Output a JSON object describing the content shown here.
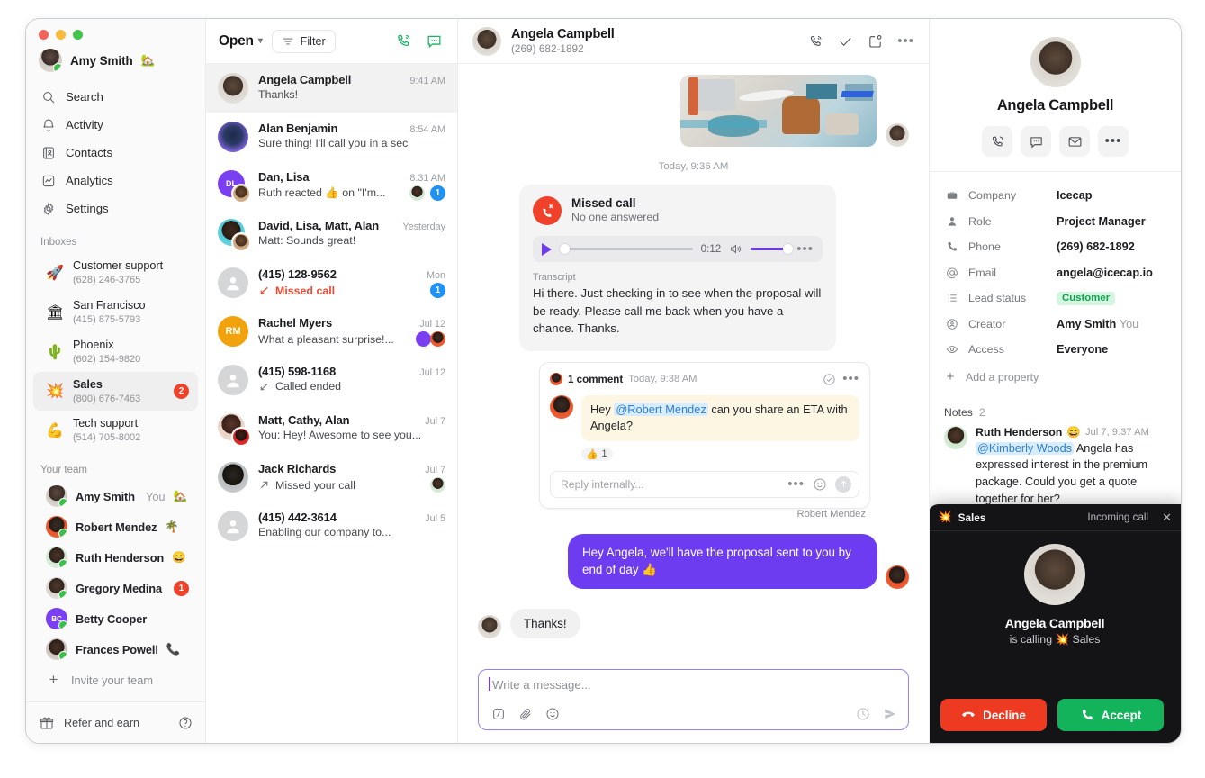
{
  "sidebar": {
    "user": {
      "name": "Amy Smith",
      "emoji": "🏡"
    },
    "nav": [
      {
        "label": "Search",
        "icon": "search-icon"
      },
      {
        "label": "Activity",
        "icon": "bell-icon"
      },
      {
        "label": "Contacts",
        "icon": "contacts-icon"
      },
      {
        "label": "Analytics",
        "icon": "analytics-icon"
      },
      {
        "label": "Settings",
        "icon": "gear-icon"
      }
    ],
    "inboxes_title": "Inboxes",
    "inboxes": [
      {
        "emoji": "🚀",
        "name": "Customer support",
        "phone": "(628) 246-3765",
        "badge": "",
        "selected": false
      },
      {
        "emoji": "🏛",
        "name": "San Francisco",
        "phone": "(415) 875-5793",
        "badge": "",
        "selected": false
      },
      {
        "emoji": "🌵",
        "name": "Phoenix",
        "phone": "(602) 154-9820",
        "badge": "",
        "selected": false
      },
      {
        "emoji": "💥",
        "name": "Sales",
        "phone": "(800) 676-7463",
        "badge": "2",
        "selected": true
      },
      {
        "emoji": "💪",
        "name": "Tech support",
        "phone": "(514) 705-8002",
        "badge": "",
        "selected": false
      }
    ],
    "team_title": "Your team",
    "team": [
      {
        "name": "Amy Smith",
        "you": "You",
        "emoji": "🏡",
        "badge": "",
        "av": "a-amy"
      },
      {
        "name": "Robert Mendez",
        "you": "",
        "emoji": "🌴",
        "badge": "",
        "av": "a-robert"
      },
      {
        "name": "Ruth Henderson",
        "you": "",
        "emoji": "😄",
        "badge": "",
        "av": "a-ruth"
      },
      {
        "name": "Gregory Medina",
        "you": "",
        "emoji": "",
        "badge": "1",
        "av": "a-greg"
      },
      {
        "name": "Betty Cooper",
        "you": "",
        "emoji": "",
        "badge": "",
        "av": "a-betty"
      },
      {
        "name": "Frances Powell",
        "you": "",
        "emoji": "📞",
        "badge": "",
        "av": "a-frances"
      }
    ],
    "invite_label": "Invite your team",
    "footer": {
      "label": "Refer and earn",
      "help": "?"
    }
  },
  "list": {
    "header": {
      "open_label": "Open",
      "filter_label": "Filter",
      "call_icon": "phone-call-icon",
      "message_icon": "new-message-icon"
    },
    "conversations": [
      {
        "name": "Angela Campbell",
        "time": "9:41 AM",
        "preview": "Thanks!",
        "preview_style": "plain",
        "av": "a-angela",
        "av2": "",
        "badge": "",
        "mini": "",
        "selected": true
      },
      {
        "name": "Alan Benjamin",
        "time": "8:54 AM",
        "preview": "Sure thing! I'll call you in a sec",
        "preview_style": "plain",
        "av": "a-alan",
        "av2": "",
        "badge": "",
        "mini": "",
        "selected": false
      },
      {
        "name": "Dan, Lisa",
        "time": "8:31 AM",
        "preview": "Ruth reacted 👍 on \"I'm...",
        "preview_style": "plain",
        "av": "a-dan",
        "av2": "a-lisa",
        "badge": "1",
        "mini": "a-ruth",
        "selected": false
      },
      {
        "name": "David, Lisa, Matt, Alan",
        "time": "Yesterday",
        "preview": "Matt: Sounds great!",
        "preview_style": "plain",
        "av": "a-david",
        "av2": "a-lisa",
        "badge": "",
        "mini": "",
        "selected": false
      },
      {
        "name": "(415) 128-9562",
        "time": "Mon",
        "preview": "Missed call",
        "preview_style": "missed",
        "av": "placeholder",
        "av2": "",
        "badge": "1",
        "mini": "",
        "selected": false
      },
      {
        "name": "Rachel Myers",
        "time": "Jul 12",
        "preview": "What a pleasant surprise!...",
        "preview_style": "plain",
        "av": "a-rm",
        "av2": "",
        "badge": "",
        "mini": "a-betty",
        "mini2": "a-robert",
        "initials": "RM",
        "selected": false
      },
      {
        "name": "(415) 598-1168",
        "time": "Jul 12",
        "preview": "Called ended",
        "preview_style": "plain",
        "av": "placeholder",
        "av2": "",
        "badge": "",
        "mini": "",
        "selected": false
      },
      {
        "name": "Matt, Cathy, Alan",
        "time": "Jul 7",
        "preview": "You: Hey! Awesome to see you...",
        "preview_style": "plain",
        "av": "a-cathy",
        "av2": "a-cathy2",
        "badge": "",
        "mini": "",
        "selected": false
      },
      {
        "name": "Jack Richards",
        "time": "Jul 7",
        "preview": "Missed your call",
        "preview_style": "plain",
        "av": "a-jack",
        "av2": "",
        "badge": "",
        "mini": "a-ruth",
        "selected": false
      },
      {
        "name": "(415) 442-3614",
        "time": "Jul 5",
        "preview": "Enabling our company to...",
        "preview_style": "plain",
        "av": "placeholder",
        "av2": "",
        "badge": "",
        "mini": "",
        "selected": false
      }
    ]
  },
  "thread": {
    "contact_name": "Angela Campbell",
    "contact_phone": "(269) 682-1892",
    "actions": [
      "phone-call-icon",
      "check-icon",
      "snooze-icon",
      "more-icon"
    ],
    "day_separator": "Today, 9:36 AM",
    "missed_call": {
      "title": "Missed call",
      "subtitle": "No one answered",
      "duration": "0:12",
      "transcript_label": "Transcript",
      "transcript": "Hi there. Just checking in to see when the proposal will be ready. Please call me back when you have a chance. Thanks."
    },
    "comment": {
      "count_label": "1 comment",
      "time": "Today, 9:38 AM",
      "text_before": "Hey ",
      "mention": "@Robert Mendez",
      "text_after": " can you share an ETA with Angela?",
      "reaction_emoji": "👍",
      "reaction_count": "1",
      "reply_placeholder": "Reply internally..."
    },
    "outgoing": {
      "author": "Robert Mendez",
      "text": "Hey Angela, we'll have the proposal sent to you by end of day 👍"
    },
    "incoming": {
      "text": "Thanks!"
    },
    "composer": {
      "placeholder": "Write a message...",
      "tools": [
        "snippet-icon",
        "attachment-icon",
        "emoji-icon"
      ],
      "right_tools": [
        "schedule-icon",
        "send-icon"
      ]
    }
  },
  "right_panel": {
    "name": "Angela Campbell",
    "actions": [
      "phone-call-icon",
      "message-icon",
      "email-icon",
      "more-icon"
    ],
    "properties": [
      {
        "icon": "briefcase-icon",
        "key": "Company",
        "value": "Icecap",
        "type": "text"
      },
      {
        "icon": "person-icon",
        "key": "Role",
        "value": "Project Manager",
        "type": "text"
      },
      {
        "icon": "phone-icon",
        "key": "Phone",
        "value": "(269) 682-1892",
        "type": "text"
      },
      {
        "icon": "at-icon",
        "key": "Email",
        "value": "angela@icecap.io",
        "type": "text"
      },
      {
        "icon": "list-icon",
        "key": "Lead status",
        "value": "Customer",
        "type": "chip"
      },
      {
        "icon": "creator-icon",
        "key": "Creator",
        "value": "Amy Smith",
        "soft": "You",
        "type": "text-soft"
      },
      {
        "icon": "eye-icon",
        "key": "Access",
        "value": "Everyone",
        "type": "text"
      }
    ],
    "add_property_label": "Add a property",
    "notes_title": "Notes",
    "notes_count": "2",
    "notes": [
      {
        "author": "Ruth Henderson",
        "emoji": "😄",
        "time": "Jul 7, 9:37 AM",
        "mention": "@Kimberly Woods",
        "text": " Angela has expressed interest in the premium package. Could you get a quote together for her?"
      }
    ]
  },
  "call_popup": {
    "queue_emoji": "💥",
    "queue_name": "Sales",
    "status": "Incoming call",
    "close": "✕",
    "caller_name": "Angela Campbell",
    "calling_text": "is calling",
    "calling_emoji": "💥",
    "calling_queue": "Sales",
    "decline_label": "Decline",
    "accept_label": "Accept"
  },
  "colors": {
    "accent_purple": "#6d3cf0",
    "green": "#12b35a",
    "red": "#ef3a22",
    "badge_red": "#f0412b",
    "badge_blue": "#1e92f5",
    "chip_green_bg": "#d5f6e0",
    "chip_green_fg": "#12a150"
  }
}
